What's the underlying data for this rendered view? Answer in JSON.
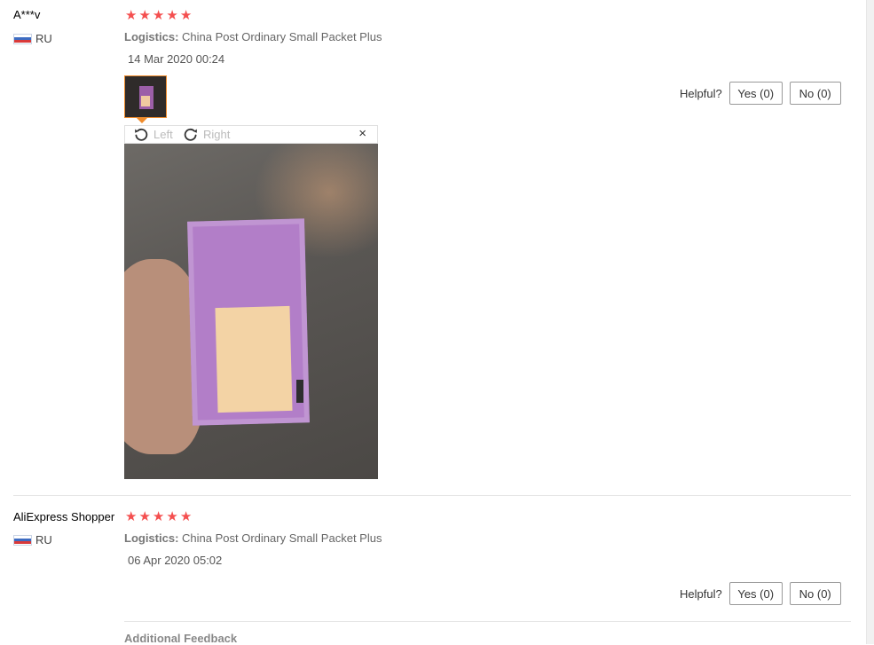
{
  "feedbacks": [
    {
      "user": "A***v",
      "country": "RU",
      "rating": 5,
      "logistics_label": "Logistics:",
      "logistics_value": "China Post Ordinary Small Packet Plus",
      "date": "14 Mar 2020 00:24",
      "viewer": {
        "rotate_left": "Left",
        "rotate_right": "Right",
        "close": "×"
      },
      "helpful": {
        "label": "Helpful?",
        "yes": "Yes (0)",
        "no": "No (0)"
      }
    },
    {
      "user": "AliExpress Shopper",
      "country": "RU",
      "rating": 5,
      "logistics_label": "Logistics:",
      "logistics_value": "China Post Ordinary Small Packet Plus",
      "date": "06 Apr 2020 05:02",
      "helpful": {
        "label": "Helpful?",
        "yes": "Yes (0)",
        "no": "No (0)"
      },
      "additional_feedback": "Additional Feedback"
    }
  ],
  "icons": {
    "star": "★",
    "star_color": "#f44f4f",
    "flag": "russia-flag-icon",
    "rotate_left": "rotate-left-icon",
    "rotate_right": "rotate-right-icon",
    "close": "close-icon"
  },
  "colors": {
    "thumb_border": "#f08c2c",
    "divider": "#e6e6e6"
  }
}
